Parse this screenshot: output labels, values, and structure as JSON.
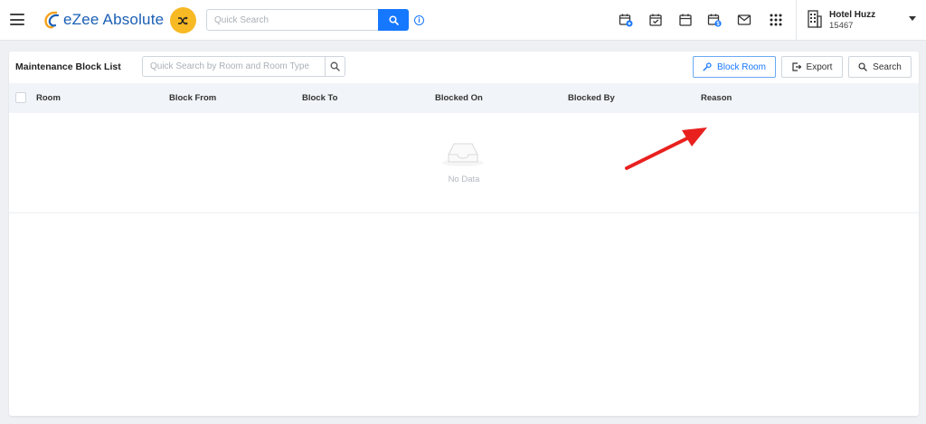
{
  "app": {
    "name": "eZee Absolute"
  },
  "header": {
    "search_placeholder": "Quick Search",
    "info_glyph": "i",
    "icons": [
      "calendar-plus-icon",
      "calendar-check-icon",
      "calendar-icon",
      "calendar-dollar-icon",
      "mail-icon",
      "apps-grid-icon"
    ]
  },
  "hotel": {
    "name": "Hotel Huzz",
    "id": "15467"
  },
  "page": {
    "title": "Maintenance Block List",
    "search_placeholder": "Quick Search by Room and Room Type",
    "buttons": {
      "block_room": "Block Room",
      "export": "Export",
      "search": "Search"
    }
  },
  "table": {
    "columns": [
      "Room",
      "Block From",
      "Block To",
      "Blocked On",
      "Blocked By",
      "Reason"
    ],
    "rows": [],
    "empty_text": "No Data"
  },
  "colors": {
    "accent": "#1677ff",
    "brand": "#1a5fb4",
    "shuffle": "#f7b924",
    "annotation_arrow": "#e8211f"
  }
}
